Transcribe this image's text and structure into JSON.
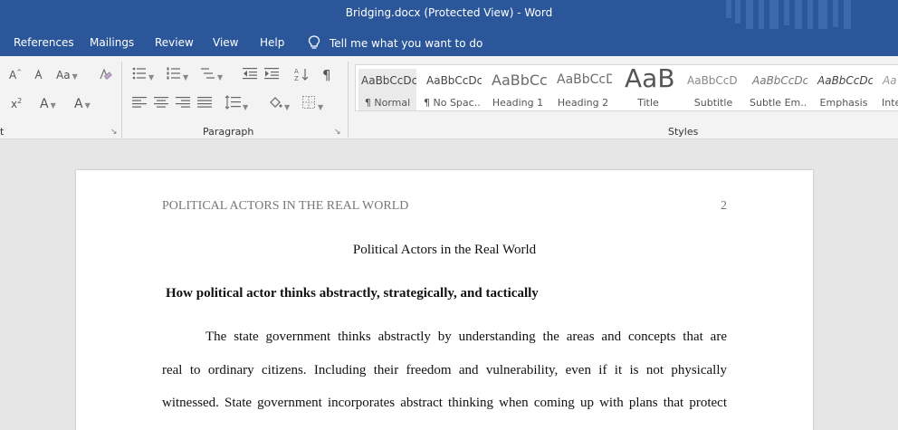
{
  "window": {
    "title": "Bridging.docx (Protected View)  -  Word"
  },
  "menu": {
    "items": [
      {
        "label": "References"
      },
      {
        "label": "Mailings"
      },
      {
        "label": "Review"
      },
      {
        "label": "View"
      },
      {
        "label": "Help"
      }
    ],
    "tell_me": "Tell me what you want to do"
  },
  "ribbon": {
    "groups": {
      "font_partial": "t",
      "paragraph": "Paragraph",
      "styles": "Styles"
    },
    "font": {
      "grow": "A",
      "grow_sup": "^",
      "case": "Aa",
      "superscript": "x",
      "superscript_mark": "2",
      "text_effects": "A",
      "font_color": "A"
    },
    "styles": [
      {
        "preview": "AaBbCcDc",
        "name": "¶ Normal"
      },
      {
        "preview": "AaBbCcDc",
        "name": "¶ No Spac..."
      },
      {
        "preview": "AaBbCc",
        "name": "Heading 1"
      },
      {
        "preview": "AaBbCcD",
        "name": "Heading 2"
      },
      {
        "preview": "AaB",
        "name": "Title"
      },
      {
        "preview": "AaBbCcD",
        "name": "Subtitle"
      },
      {
        "preview": "AaBbCcDc",
        "name": "Subtle Em..."
      },
      {
        "preview": "AaBbCcDc",
        "name": "Emphasis"
      },
      {
        "preview": "Aa",
        "name": "Inte"
      }
    ]
  },
  "document": {
    "header_text": "POLITICAL ACTORS IN THE REAL WORLD",
    "page_number": "2",
    "title": "Political Actors in the Real World",
    "heading": "How political actor thinks abstractly, strategically, and tactically",
    "paragraph_lines": [
      "The state government thinks abstractly by understanding the areas and concepts that are",
      "real to ordinary citizens. Including their freedom and vulnerability, even if it is not physically",
      "witnessed. State government incorporates abstract thinking when coming up with plans that protect"
    ]
  }
}
